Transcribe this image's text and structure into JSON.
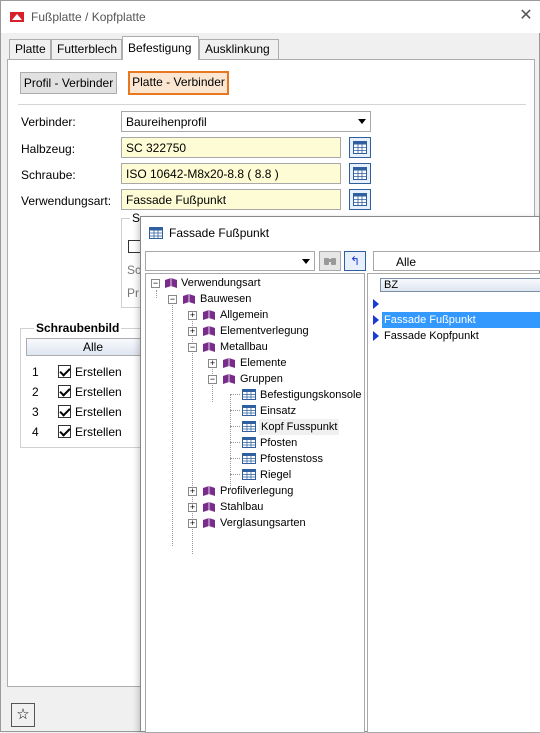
{
  "window": {
    "title": "Fußplatte / Kopfplatte"
  },
  "tabs": [
    {
      "label": "Platte"
    },
    {
      "label": "Futterblech"
    },
    {
      "label": "Befestigung"
    },
    {
      "label": "Ausklinkung"
    }
  ],
  "subtabs": {
    "profil": "Profil - Verbinder",
    "platte": "Platte - Verbinder"
  },
  "form": {
    "verbinder": {
      "label": "Verbinder:",
      "value": "Baureihenprofil"
    },
    "halbzeug": {
      "label": "Halbzeug:",
      "value": "SC  322750"
    },
    "schraube": {
      "label": "Schraube:",
      "value": "ISO 10642-M8x20-8.8  ( 8.8 )"
    },
    "verwendungsart": {
      "label": "Verwendungsart:",
      "value": "Fassade Fußpunkt"
    }
  },
  "hidden_group": {
    "title_fragment": "S",
    "label1": "Sc",
    "label2": "Pr"
  },
  "schraubenbild": {
    "title": "Schraubenbild",
    "all_label": "Alle",
    "rows": [
      {
        "num": "1",
        "label": "Erstellen"
      },
      {
        "num": "2",
        "label": "Erstellen"
      },
      {
        "num": "3",
        "label": "Erstellen"
      },
      {
        "num": "4",
        "label": "Erstellen"
      }
    ]
  },
  "popup": {
    "title": "Fassade Fußpunkt",
    "filter_value": "",
    "list_filter": "Alle",
    "list_header": "BZ",
    "tree": [
      {
        "label": "Verwendungsart",
        "icon": "book-icon"
      },
      {
        "label": "Bauwesen",
        "icon": "book-icon"
      },
      {
        "label": "Allgemein",
        "icon": "book-icon"
      },
      {
        "label": "Elementverlegung",
        "icon": "book-icon"
      },
      {
        "label": "Metallbau",
        "icon": "book-icon"
      },
      {
        "label": "Elemente",
        "icon": "book-icon"
      },
      {
        "label": "Gruppen",
        "icon": "book-icon"
      },
      {
        "label": "Befestigungskonsole",
        "icon": "table-icon"
      },
      {
        "label": "Einsatz",
        "icon": "table-icon"
      },
      {
        "label": "Kopf Fusspunkt",
        "icon": "table-icon"
      },
      {
        "label": "Pfosten",
        "icon": "table-icon"
      },
      {
        "label": "Pfostenstoss",
        "icon": "table-icon"
      },
      {
        "label": "Riegel",
        "icon": "table-icon"
      },
      {
        "label": "Profilverlegung",
        "icon": "book-icon"
      },
      {
        "label": "Stahlbau",
        "icon": "book-icon"
      },
      {
        "label": "Verglasungsarten",
        "icon": "book-icon"
      }
    ],
    "list_rows": [
      {
        "label": ""
      },
      {
        "label": "Fassade Fußpunkt"
      },
      {
        "label": "Fassade Kopfpunkt"
      }
    ]
  },
  "colors": {
    "accent": "#e87722",
    "selection": "#3399ff",
    "book": "#7a2c8c",
    "field_bg": "#fefcd4"
  }
}
